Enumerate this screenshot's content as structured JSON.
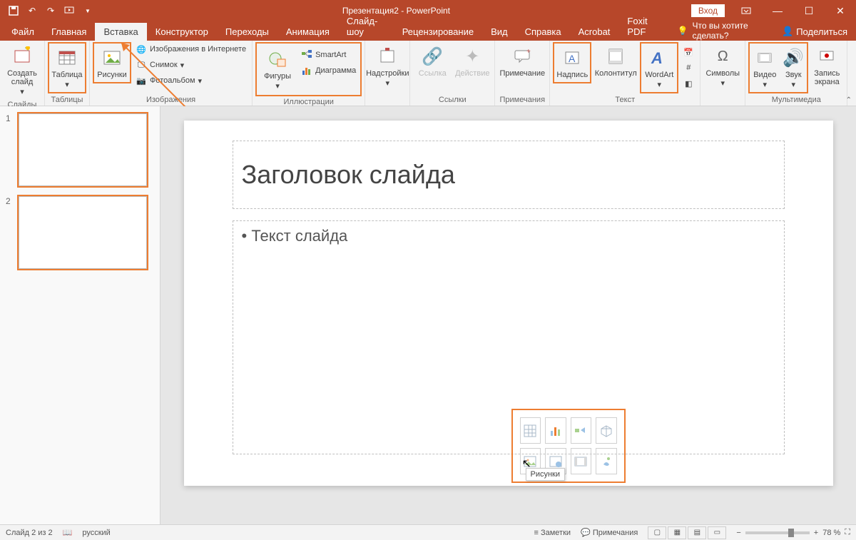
{
  "titlebar": {
    "title": "Презентация2 - PowerPoint",
    "signin": "Вход"
  },
  "tabs": {
    "file": "Файл",
    "home": "Главная",
    "insert": "Вставка",
    "design": "Конструктор",
    "transitions": "Переходы",
    "animation": "Анимация",
    "slideshow": "Слайд-шоу",
    "review": "Рецензирование",
    "view": "Вид",
    "help": "Справка",
    "acrobat": "Acrobat",
    "foxit": "Foxit PDF",
    "tellme": "Что вы хотите сделать?",
    "share": "Поделиться"
  },
  "ribbon": {
    "slides": {
      "new": "Создать слайд",
      "group": "Слайды"
    },
    "tables": {
      "btn": "Таблица",
      "group": "Таблицы"
    },
    "images": {
      "pictures": "Рисунки",
      "online": "Изображения в Интернете",
      "screenshot": "Снимок",
      "album": "Фотоальбом",
      "group": "Изображения"
    },
    "illus": {
      "shapes": "Фигуры",
      "smartart": "SmartArt",
      "chart": "Диаграмма",
      "group": "Иллюстрации"
    },
    "addins": {
      "btn": "Надстройки"
    },
    "links": {
      "link": "Ссылка",
      "action": "Действие",
      "group": "Ссылки"
    },
    "comments": {
      "btn": "Примечание",
      "group": "Примечания"
    },
    "text": {
      "textbox": "Надпись",
      "headerfooter": "Колонтитул",
      "wordart": "WordArt",
      "group": "Текст"
    },
    "symbols": {
      "btn": "Символы"
    },
    "media": {
      "video": "Видео",
      "audio": "Звук",
      "screenrec": "Запись экрана",
      "group": "Мультимедиа"
    }
  },
  "thumbs": {
    "n1": "1",
    "n2": "2"
  },
  "slide": {
    "title": "Заголовок слайда",
    "body": "Текст слайда",
    "tooltip": "Рисунки"
  },
  "status": {
    "slide": "Слайд 2 из 2",
    "lang": "русский",
    "notes": "Заметки",
    "comments": "Примечания",
    "zoom": "78 %"
  }
}
